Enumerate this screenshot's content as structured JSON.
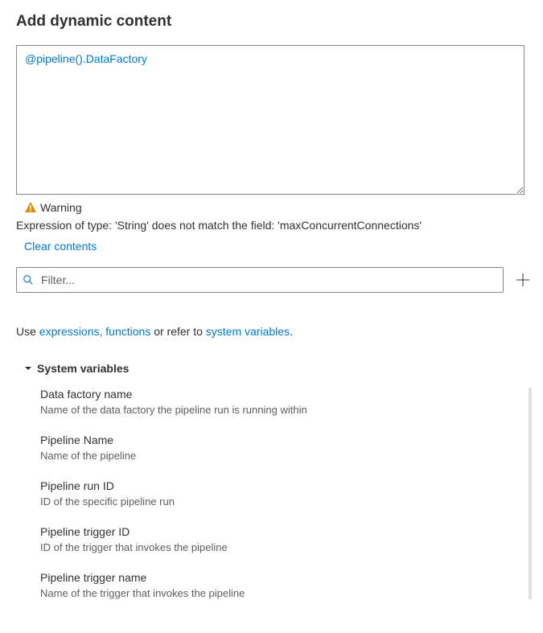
{
  "title": "Add dynamic content",
  "expression": "@pipeline().DataFactory",
  "warning": {
    "label": "Warning",
    "message": "Expression of type: 'String' does not match the field: 'maxConcurrentConnections'"
  },
  "clear_label": "Clear contents",
  "filter": {
    "placeholder": "Filter..."
  },
  "help": {
    "prefix": "Use ",
    "link1": "expressions, functions",
    "middle": " or refer to ",
    "link2": "system variables",
    "suffix": "."
  },
  "section": {
    "title": "System variables",
    "items": [
      {
        "title": "Data factory name",
        "desc": "Name of the data factory the pipeline run is running within"
      },
      {
        "title": "Pipeline Name",
        "desc": "Name of the pipeline"
      },
      {
        "title": "Pipeline run ID",
        "desc": "ID of the specific pipeline run"
      },
      {
        "title": "Pipeline trigger ID",
        "desc": "ID of the trigger that invokes the pipeline"
      },
      {
        "title": "Pipeline trigger name",
        "desc": "Name of the trigger that invokes the pipeline"
      }
    ]
  }
}
